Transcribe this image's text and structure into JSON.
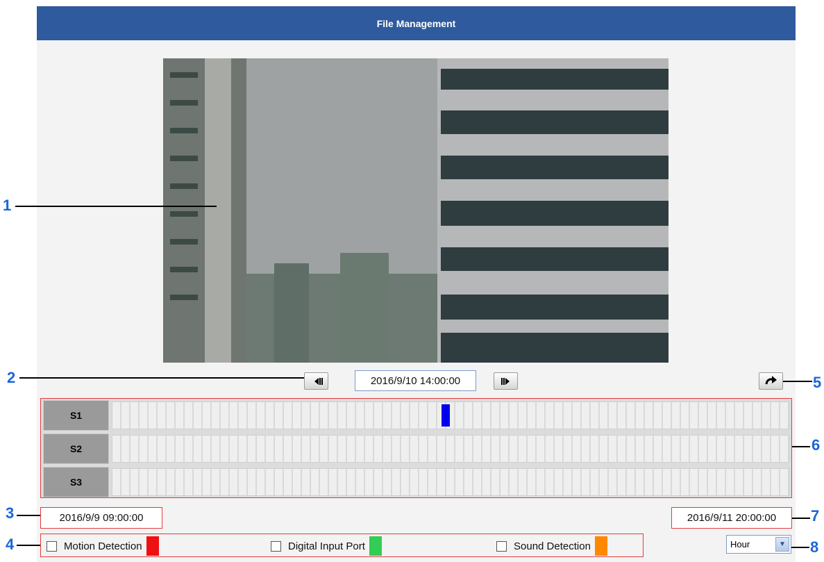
{
  "header": {
    "title": "File Management"
  },
  "player": {
    "current_time": "2016/9/10 14:00:00",
    "prev_icon": "step-back-icon",
    "next_icon": "step-forward-icon",
    "go_icon": "redo-arrow-icon"
  },
  "timeline": {
    "rows": [
      {
        "label": "S1",
        "marker": true
      },
      {
        "label": "S2",
        "marker": false
      },
      {
        "label": "S3",
        "marker": false
      }
    ],
    "marker_color": "#0000ee",
    "start_time": "2016/9/9 09:00:00",
    "end_time": "2016/9/11 20:00:00"
  },
  "legend": {
    "motion": {
      "label": "Motion Detection",
      "color": "#ee1111"
    },
    "digital_input": {
      "label": "Digital Input Port",
      "color": "#33cc55"
    },
    "sound": {
      "label": "Sound Detection",
      "color": "#ff8800"
    }
  },
  "scale_select": {
    "value": "Hour"
  },
  "callouts": [
    "1",
    "2",
    "3",
    "4",
    "5",
    "6",
    "7",
    "8"
  ],
  "colors": {
    "header_bg": "#2f5a9e",
    "accent_red": "#e53a3a",
    "callout_blue": "#1a66d9"
  }
}
